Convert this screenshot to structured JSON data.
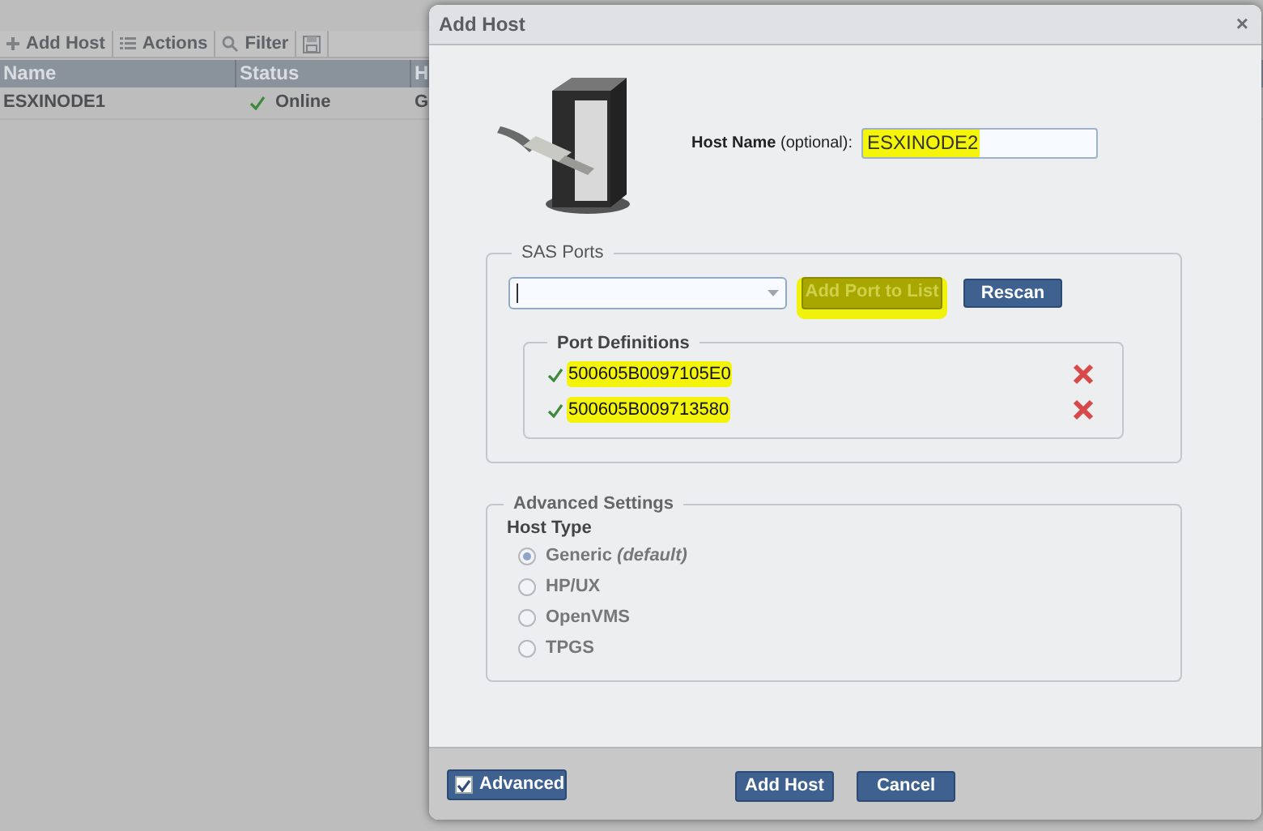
{
  "background": {
    "toolbar": [
      {
        "kind": "add",
        "label": "Add Host"
      },
      {
        "kind": "actions",
        "label": "Actions"
      },
      {
        "kind": "filter",
        "label": "Filter"
      },
      {
        "kind": "save"
      }
    ],
    "table": {
      "columns": [
        "Name",
        "Status",
        "H"
      ],
      "rows": [
        {
          "name": "ESXINODE1",
          "status": "Online",
          "online": true,
          "column_3": "G"
        }
      ]
    }
  },
  "dialog": {
    "title": "Add Host",
    "close": "×",
    "host_name": {
      "label": "Host Name",
      "hint": "(optional):",
      "value": "ESXINODE2",
      "highlighted": true
    },
    "sas_ports": {
      "title": "SAS Ports",
      "add_button": {
        "label": "Add Port to List",
        "disabled": true,
        "highlighted": true
      },
      "rescan_button": "Rescan",
      "port_definitions": {
        "title": "Port Definitions",
        "ports": [
          {
            "wwn": "500605B0097105E0",
            "valid": true,
            "highlighted": true
          },
          {
            "wwn": "500605B009713580",
            "valid": true,
            "highlighted": true
          }
        ]
      }
    },
    "advanced_settings": {
      "title": "Advanced Settings",
      "host_type_label": "Host Type",
      "options": [
        {
          "label": "Generic *(default)*",
          "selected": true
        },
        {
          "label": "HP/UX",
          "selected": false
        },
        {
          "label": "OpenVMS",
          "selected": false
        },
        {
          "label": "TPGS",
          "selected": false
        }
      ]
    },
    "footer": {
      "advanced": {
        "label": "Advanced",
        "checked": true
      },
      "buttons": [
        "Add Host",
        "Cancel"
      ]
    }
  }
}
